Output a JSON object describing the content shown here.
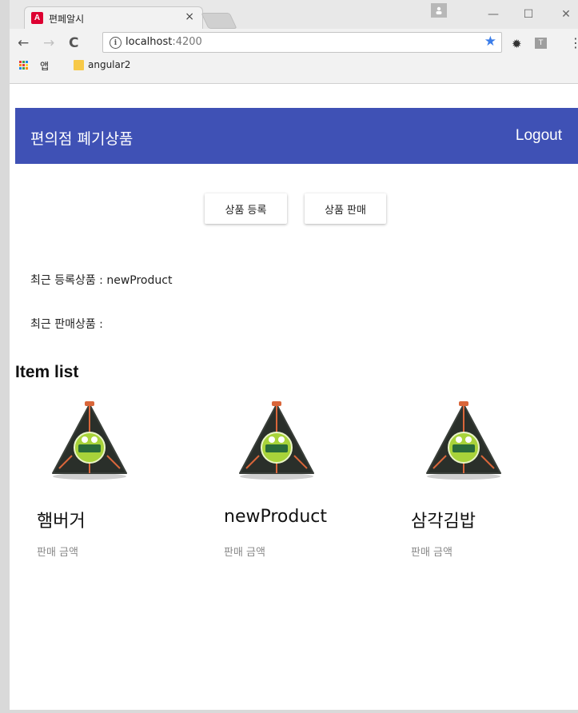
{
  "browser": {
    "tab_title": "편페알시",
    "tab_close": "×",
    "address": {
      "host": "localhost",
      "port": ":4200"
    },
    "bookmarks": {
      "apps_label": "앱",
      "folder_label": "angular2"
    },
    "extension_label": "T",
    "window_controls": {
      "minimize": "—",
      "maximize": "☐",
      "close": "✕"
    }
  },
  "app": {
    "title": "편의점 폐기상품",
    "logout_label": "Logout",
    "colors": {
      "primary": "#3f51b5"
    },
    "buttons": {
      "register": "상품 등록",
      "sell": "상품 판매"
    },
    "recent_registered": "최근 등록상품 : newProduct",
    "recent_sold": "최근 판매상품 :",
    "list_title": "Item list",
    "items": [
      {
        "name": "햄버거",
        "price_label": "판매 금액"
      },
      {
        "name": "newProduct",
        "price_label": "판매 금액"
      },
      {
        "name": "삼각김밥",
        "price_label": "판매 금액"
      }
    ]
  }
}
